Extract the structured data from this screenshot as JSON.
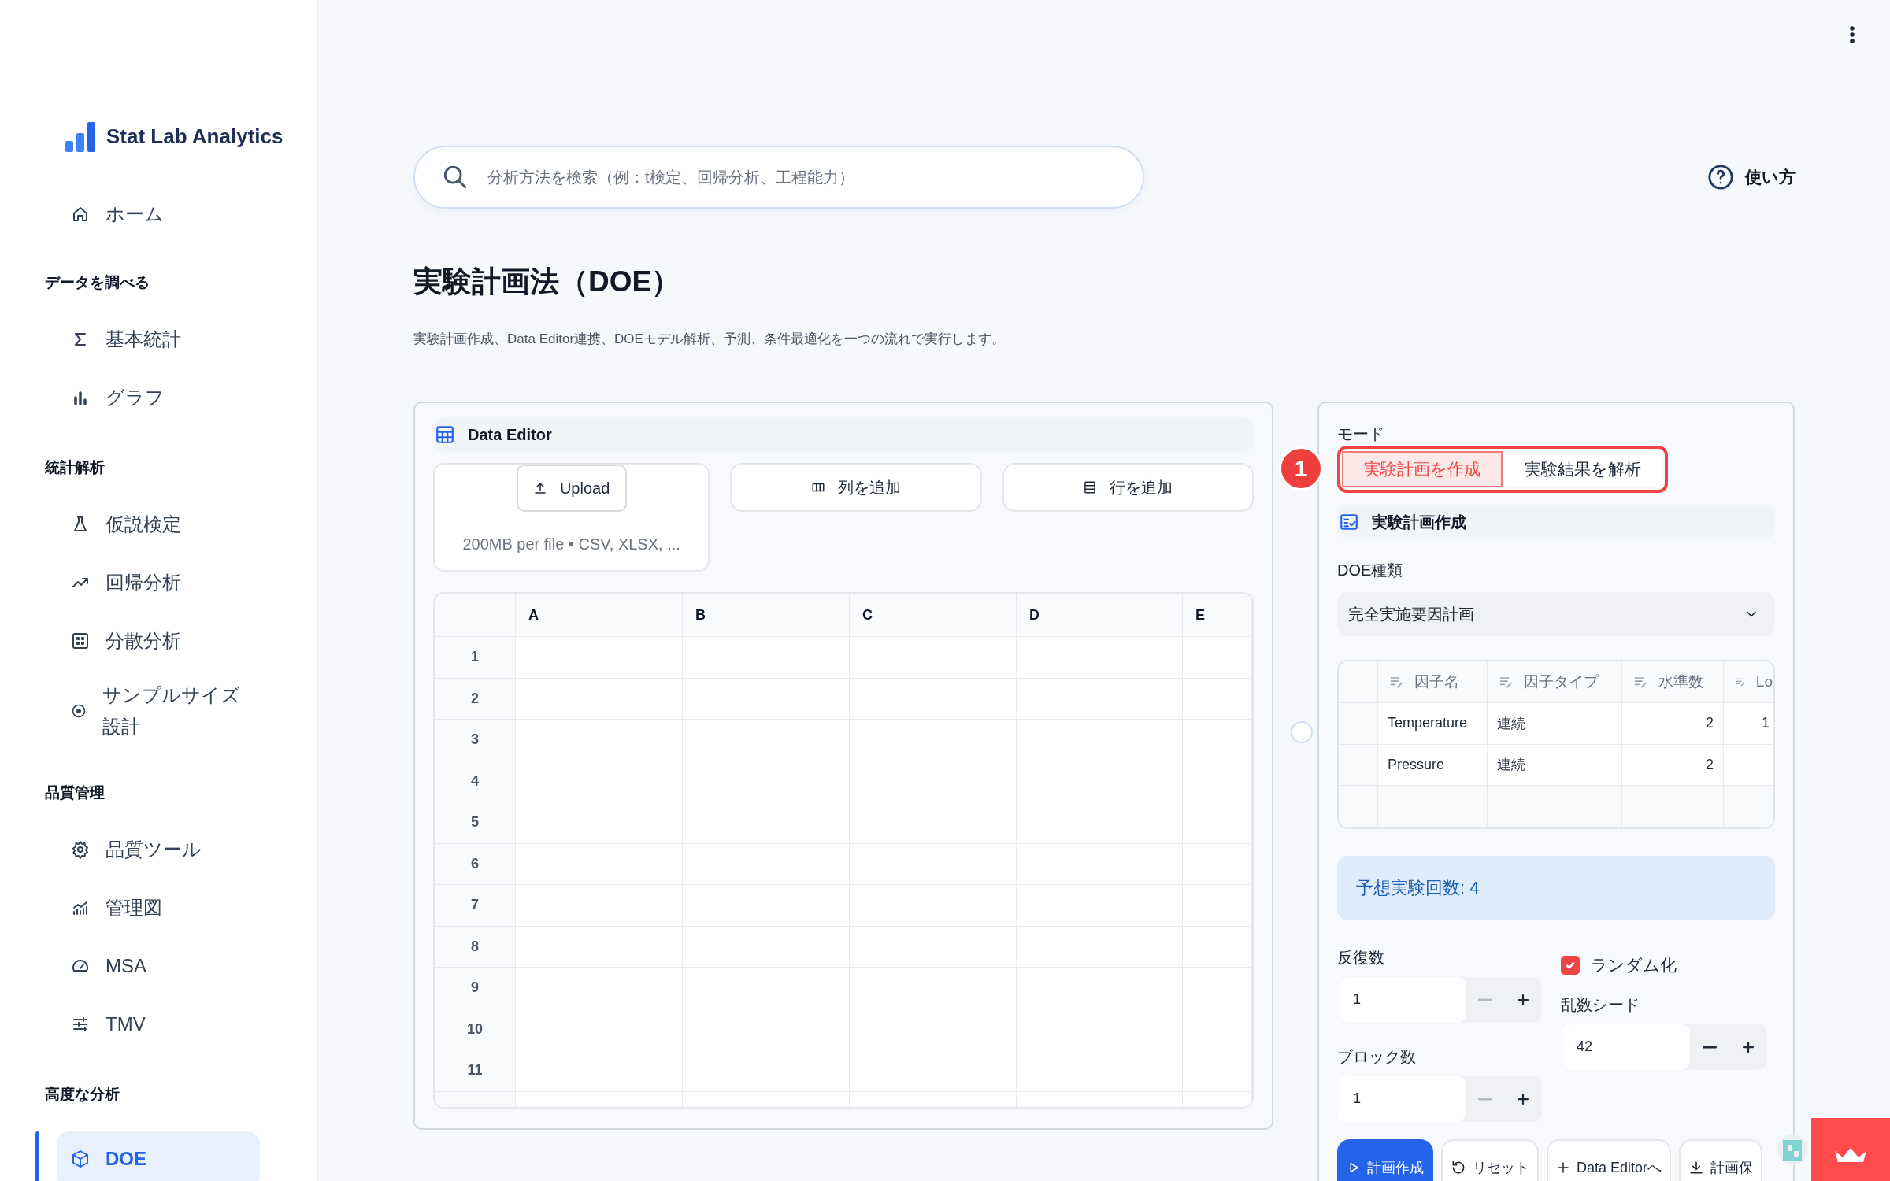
{
  "sidebar": {
    "brand": "Stat Lab Analytics",
    "groups": [
      {
        "items": [
          {
            "label": "ホーム",
            "selected": false
          }
        ]
      },
      {
        "title": "データを調べる",
        "items": [
          {
            "label": "基本統計",
            "selected": false
          },
          {
            "label": "グラフ",
            "selected": false
          }
        ]
      },
      {
        "title": "統計解析",
        "items": [
          {
            "label": "仮説検定",
            "selected": false
          },
          {
            "label": "回帰分析",
            "selected": false
          },
          {
            "label": "分散分析",
            "selected": false
          },
          {
            "label": "サンプルサイズ設計",
            "selected": false
          }
        ]
      },
      {
        "title": "品質管理",
        "items": [
          {
            "label": "品質ツール",
            "selected": false
          },
          {
            "label": "管理図",
            "selected": false
          },
          {
            "label": "MSA",
            "selected": false
          },
          {
            "label": "TMV",
            "selected": false
          }
        ]
      },
      {
        "title": "高度な分析",
        "items": [
          {
            "label": "DOE",
            "selected": true
          }
        ]
      }
    ]
  },
  "search": {
    "placeholder": "分析方法を検索（例：t検定、回帰分析、工程能力）"
  },
  "help_link": {
    "label": "使い方"
  },
  "page": {
    "title": "実験計画法（DOE）",
    "description": "実験計画作成、Data Editor連携、DOEモデル解析、予測、条件最適化を一つの流れで実行します。"
  },
  "data_editor": {
    "title": "Data Editor",
    "upload": {
      "button": "Upload",
      "hint": "200MB per file • CSV, XLSX, ..."
    },
    "actions": [
      {
        "label": "列を追加"
      },
      {
        "label": "行を追加"
      }
    ],
    "columns": [
      "A",
      "B",
      "C",
      "D",
      "E"
    ],
    "rows": [
      "1",
      "2",
      "3",
      "4",
      "5",
      "6",
      "7",
      "8",
      "9",
      "10",
      "11"
    ]
  },
  "design_panel": {
    "mode": {
      "label": "モード",
      "options": [
        {
          "label": "実験計画を作成",
          "selected": true
        },
        {
          "label": "実験結果を解析",
          "selected": false
        }
      ]
    },
    "annotation": {
      "label": "1"
    },
    "section_title": "実験計画作成",
    "doe_type": {
      "label": "DOE種類",
      "value": "完全実施要因計画"
    },
    "factors": {
      "columns": [
        "因子名",
        "因子タイプ",
        "水準数",
        "Lo"
      ],
      "rows": [
        {
          "name": "Temperature",
          "type": "連続",
          "levels": "2",
          "lo": "1"
        },
        {
          "name": "Pressure",
          "type": "連続",
          "levels": "2"
        }
      ]
    },
    "estimate": "予想実験回数: 4",
    "replicates": {
      "label": "反復数",
      "value": "1",
      "decrement_disabled": true
    },
    "blocks": {
      "label": "ブロック数",
      "value": "1",
      "decrement_disabled": true
    },
    "randomize": {
      "label": "ランダム化",
      "checked": true
    },
    "seed": {
      "label": "乱数シード",
      "value": "42",
      "decrement_disabled": false
    },
    "buttons": [
      {
        "label": "計画作成",
        "kind": "primary"
      },
      {
        "label": "リセット",
        "kind": "secondary"
      },
      {
        "label": "Data Editorへ",
        "kind": "secondary"
      },
      {
        "label": "計画保",
        "kind": "secondary"
      }
    ]
  }
}
